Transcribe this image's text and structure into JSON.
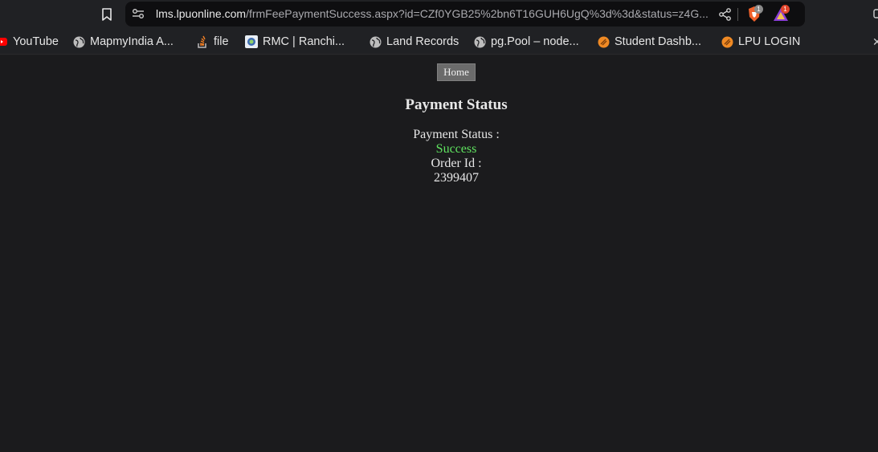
{
  "browser": {
    "url_host": "lms.lpuonline.com",
    "url_path": "/frmFeePaymentSuccess.aspx?id=CZf0YGB25%2bn6T16GUH6UgQ%3d%3d&status=z4G...",
    "shield_badge": "1",
    "rewards_badge": "1",
    "icons": {
      "bookmark": "bookmark-icon",
      "site_info": "tune-icon",
      "share": "share-icon",
      "shield": "brave-shield-icon",
      "rewards": "brave-rewards-icon"
    }
  },
  "bookmarks": [
    {
      "label": "YouTube",
      "icon": "youtube-icon"
    },
    {
      "label": "MapmyIndia A...",
      "icon": "globe-icon"
    },
    {
      "label": "file",
      "icon": "stackoverflow-icon"
    },
    {
      "label": "RMC | Ranchi...",
      "icon": "rmc-logo-icon"
    },
    {
      "label": "Land Records",
      "icon": "globe-icon"
    },
    {
      "label": "pg.Pool – node...",
      "icon": "globe-icon"
    },
    {
      "label": "Student Dashb...",
      "icon": "lpu-icon"
    },
    {
      "label": "LPU LOGIN",
      "icon": "lpu-icon"
    }
  ],
  "page": {
    "home_label": "Home",
    "title": "Payment Status",
    "status_label": "Payment Status :",
    "status_value": "Success",
    "order_label": "Order Id :",
    "order_value": "2399407"
  },
  "colors": {
    "success": "#5fe35f",
    "background": "#1b1b1d",
    "button": "#6b6b6b"
  }
}
